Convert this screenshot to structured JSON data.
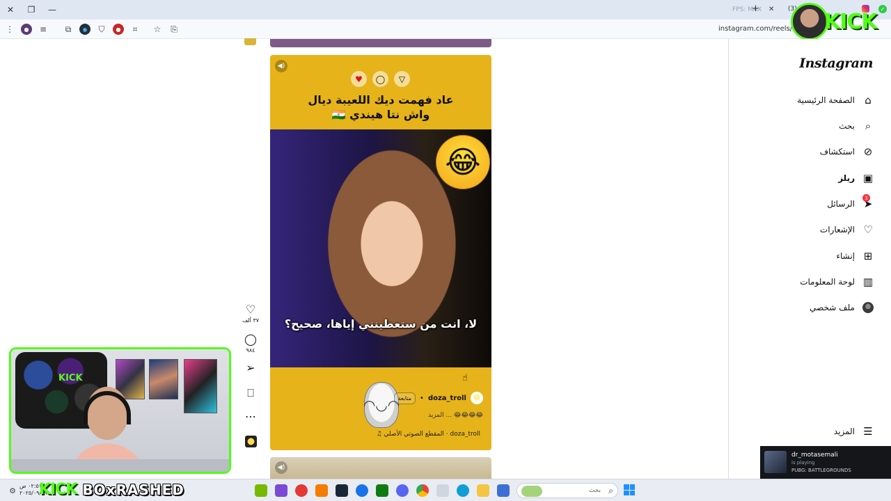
{
  "browser": {
    "tab_count": "(3)",
    "tab_hint": "FPS: MAX",
    "url": "instagram.com/reels/DO3"
  },
  "overlay": {
    "kick_logo": "KICK",
    "accent": "#53fc18"
  },
  "instagram": {
    "logo": "Instagram",
    "nav": [
      {
        "label": "الصفحة الرئيسية",
        "icon": "home-icon"
      },
      {
        "label": "بحث",
        "icon": "search-icon"
      },
      {
        "label": "استكشاف",
        "icon": "compass-icon"
      },
      {
        "label": "ريلز",
        "icon": "reels-icon"
      },
      {
        "label": "الرسائل",
        "icon": "messages-icon",
        "badge": "3"
      },
      {
        "label": "الإشعارات",
        "icon": "heart-icon"
      },
      {
        "label": "إنشاء",
        "icon": "create-icon"
      },
      {
        "label": "لوحة المعلومات",
        "icon": "dashboard-icon"
      },
      {
        "label": "ملف شخصي",
        "icon": "profile-icon"
      }
    ],
    "more_label": "المزيد"
  },
  "reel": {
    "caption_line1": "عاد فهمت ديك اللعيبة ديال",
    "caption_line2": "واش نتا هيندي 🇮🇳",
    "subtitle": "لا، انت من ستعطينني إياها، صحيح؟",
    "author": "doza_troll",
    "follow_label": "متابعة",
    "description": "😂😂😂😂 ... المزيد",
    "audio": "doza_troll · المقطع الصوتي الأصلي ♫",
    "likes": "٣٧ ألف",
    "comments": "٩٨٤"
  },
  "taskbar": {
    "time": "٠٢:٥١ ص",
    "date": "٢٠٢٥/٠٩/٠٩",
    "banner_kick": "KICK",
    "banner_name": "BOxRASHED",
    "search_placeholder": "بحث"
  },
  "notification": {
    "user": "dr_motasemali",
    "status": "is playing",
    "game": "PUBG: BATTLEGROUNDS"
  }
}
